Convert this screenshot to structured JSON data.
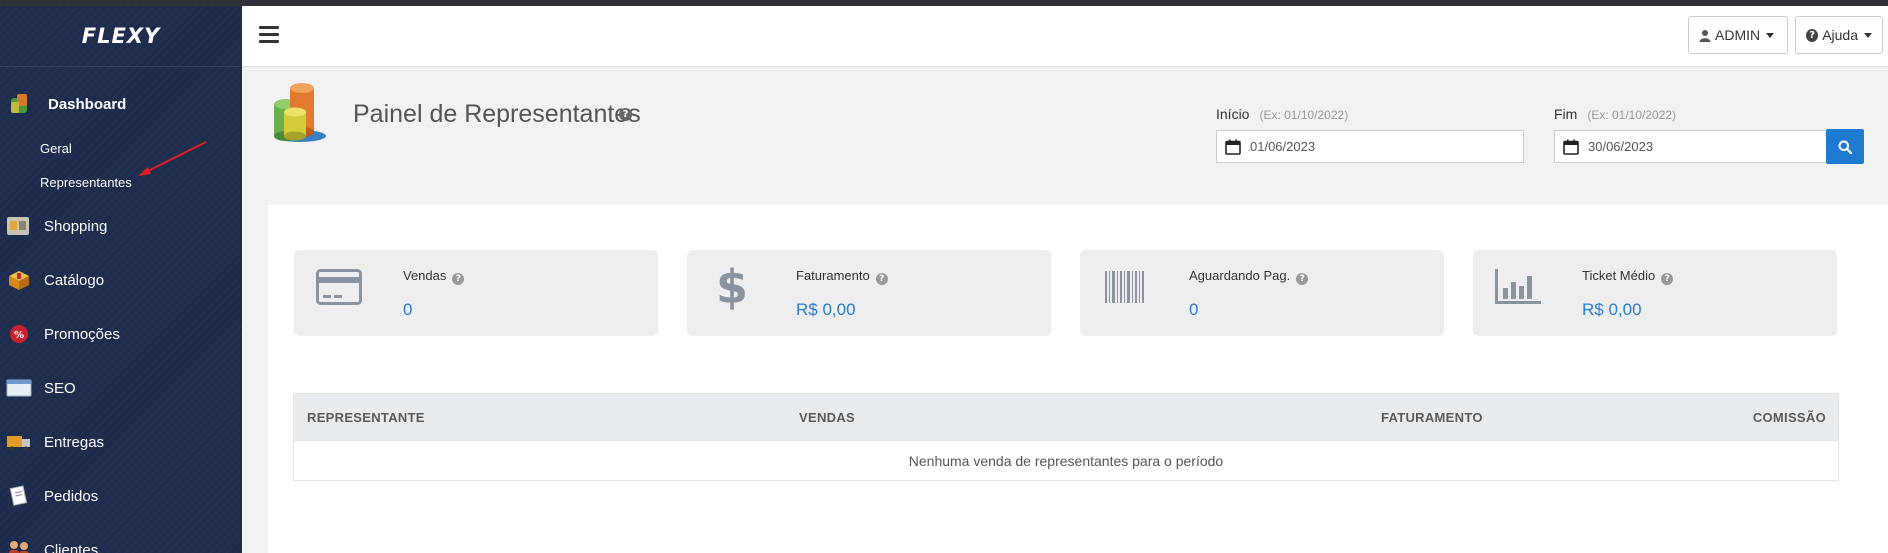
{
  "sidebar": {
    "logo": "FLEXY",
    "active_item": {
      "label": "Dashboard",
      "icon": "dashboard-icon"
    },
    "subitems": [
      {
        "label": "Geral"
      },
      {
        "label": "Representantes"
      }
    ],
    "items": [
      {
        "label": "Shopping",
        "icon": "shopping-icon"
      },
      {
        "label": "Catálogo",
        "icon": "catalog-icon"
      },
      {
        "label": "Promoções",
        "icon": "promotions-icon"
      },
      {
        "label": "SEO",
        "icon": "seo-icon"
      },
      {
        "label": "Entregas",
        "icon": "delivery-truck-icon"
      },
      {
        "label": "Pedidos",
        "icon": "orders-icon"
      },
      {
        "label": "Clientes",
        "icon": "customers-icon"
      }
    ]
  },
  "header": {
    "admin_label": "ADMIN",
    "help_label": "Ajuda"
  },
  "page": {
    "title": "Painel de Representantes",
    "start": {
      "label": "Início",
      "hint": "(Ex: 01/10/2022)",
      "value": "01/06/2023"
    },
    "end": {
      "label": "Fim",
      "hint": "(Ex: 01/10/2022)",
      "value": "30/06/2023"
    }
  },
  "cards": [
    {
      "label": "Vendas",
      "value": "0",
      "icon": "credit-card-icon"
    },
    {
      "label": "Faturamento",
      "value": "R$ 0,00",
      "icon": "dollar-icon"
    },
    {
      "label": "Aguardando Pag.",
      "value": "0",
      "icon": "barcode-icon"
    },
    {
      "label": "Ticket Médio",
      "value": "R$ 0,00",
      "icon": "bar-chart-icon"
    }
  ],
  "table": {
    "columns": [
      "REPRESENTANTE",
      "VENDAS",
      "FATURAMENTO",
      "COMISSÃO"
    ],
    "empty_message": "Nenhuma venda de representantes para o período"
  },
  "colors": {
    "sidebar_bg": "#1d2b4c",
    "accent": "#1e7bd1",
    "value_text": "#2a7bd1"
  }
}
